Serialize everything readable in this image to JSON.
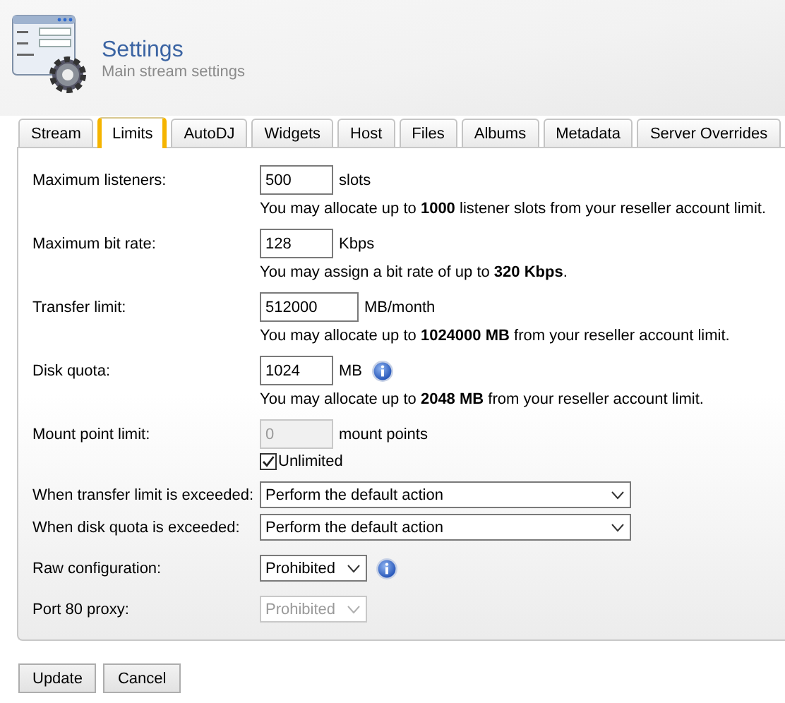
{
  "header": {
    "title": "Settings",
    "subtitle": "Main stream settings"
  },
  "tabs": [
    {
      "label": "Stream",
      "selected": false
    },
    {
      "label": "Limits",
      "selected": true
    },
    {
      "label": "AutoDJ",
      "selected": false
    },
    {
      "label": "Widgets",
      "selected": false
    },
    {
      "label": "Host",
      "selected": false
    },
    {
      "label": "Files",
      "selected": false
    },
    {
      "label": "Albums",
      "selected": false
    },
    {
      "label": "Metadata",
      "selected": false
    },
    {
      "label": "Server Overrides",
      "selected": false
    }
  ],
  "fields": [
    {
      "kind": "input",
      "label": "Maximum listeners:",
      "value": "500",
      "unit": "slots",
      "info": false,
      "disabled": false,
      "note": "You may allocate up to **1000** listener slots from your reseller account limit."
    },
    {
      "kind": "input",
      "label": "Maximum bit rate:",
      "value": "128",
      "unit": "Kbps",
      "info": false,
      "disabled": false,
      "note": "You may assign a bit rate of up to **320 Kbps**."
    },
    {
      "kind": "input",
      "label": "Transfer limit:",
      "value": "512000",
      "unit": "MB/month",
      "info": false,
      "disabled": false,
      "note": "You may allocate up to **1024000 MB** from your reseller account limit."
    },
    {
      "kind": "input",
      "label": "Disk quota:",
      "value": "1024",
      "unit": "MB",
      "info": true,
      "disabled": false,
      "note": "You may allocate up to **2048 MB** from your reseller account limit."
    },
    {
      "kind": "input",
      "label": "Mount point limit:",
      "value": "0",
      "unit": "mount points",
      "info": false,
      "disabled": true,
      "checkbox": {
        "label": "Unlimited",
        "checked": true
      }
    },
    {
      "kind": "wide-select",
      "label": "When transfer limit is exceeded:",
      "value": "Perform the default action",
      "info": false,
      "disabled": false
    },
    {
      "kind": "wide-select",
      "label": "When disk quota is exceeded:",
      "value": "Perform the default action",
      "info": false,
      "disabled": false
    },
    {
      "kind": "select",
      "label": "Raw configuration:",
      "value": "Prohibited",
      "info": true,
      "disabled": false
    },
    {
      "kind": "select",
      "label": "Port 80 proxy:",
      "value": "Prohibited",
      "info": false,
      "disabled": true
    }
  ],
  "buttons": [
    "Update",
    "Cancel"
  ]
}
